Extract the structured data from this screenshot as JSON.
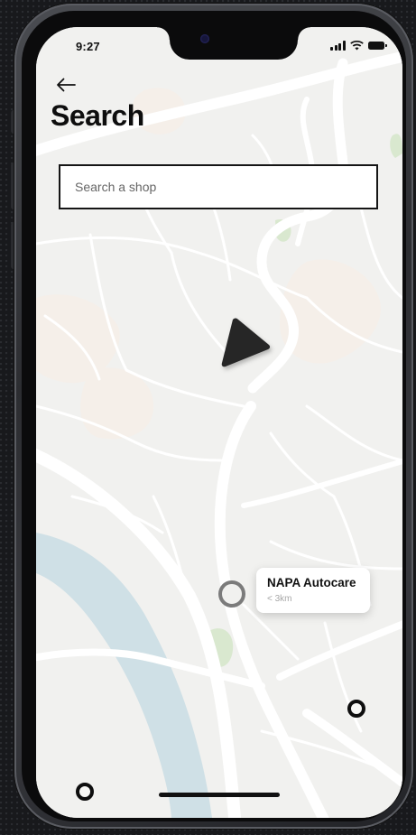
{
  "status_bar": {
    "time": "9:27"
  },
  "header": {
    "back_icon": "arrow-left-icon",
    "title": "Search"
  },
  "search": {
    "placeholder": "Search a shop",
    "value": ""
  },
  "map": {
    "location_marker_icon": "navigation-arrow-icon",
    "shop": {
      "name": "NAPA Autocare",
      "distance": "< 3km"
    }
  },
  "colors": {
    "map_background": "#f1f1ef",
    "road": "#ffffff",
    "river": "#cfe0e6",
    "park": "#d9e8cf",
    "sand": "#f5efe9",
    "text_primary": "#0e0e0e",
    "marker_dark": "#262626"
  }
}
